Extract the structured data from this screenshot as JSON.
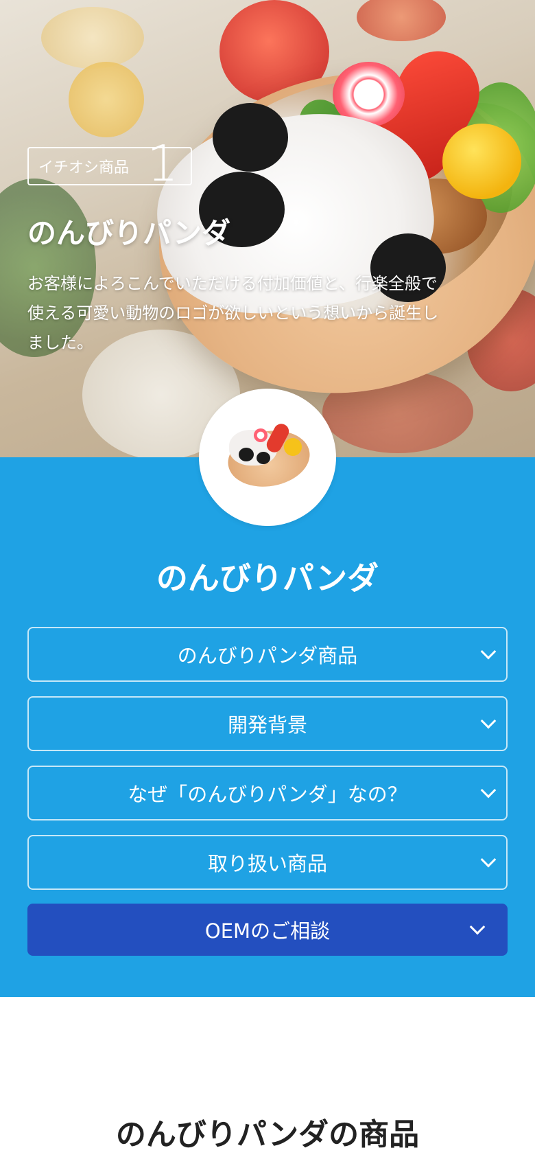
{
  "hero": {
    "badge_label": "イチオシ商品",
    "badge_number": "1",
    "title": "のんびりパンダ",
    "description": "お客様によろこんでいただける付加価値と、行楽全般で使える可愛い動物のロゴが欲しいという想いから誕生しました。",
    "image_icon": "bento-box-image"
  },
  "section": {
    "thumbnail_icon": "bento-thumbnail-image",
    "title": "のんびりパンダ",
    "accent_color": "#1fa2e4",
    "oem_color": "#234fbf"
  },
  "accordion": [
    {
      "label": "のんびりパンダ商品"
    },
    {
      "label": "開発背景"
    },
    {
      "label": "なぜ「のんびりパンダ」なの？"
    },
    {
      "label": "取り扱い商品"
    }
  ],
  "oem": {
    "label": "OEMのご相談"
  },
  "products": {
    "heading": "のんびりパンダの商品"
  }
}
